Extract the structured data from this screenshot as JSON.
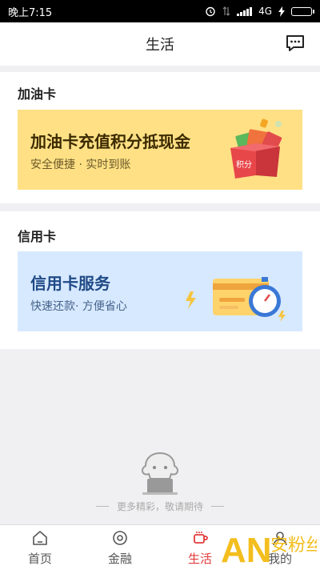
{
  "status_bar": {
    "time": "晚上7:15",
    "network": "4G"
  },
  "header": {
    "title": "生活",
    "message_icon": "message-icon"
  },
  "fuel_card": {
    "section_title": "加油卡",
    "card_title": "加油卡充值积分抵现金",
    "card_subtitle": "安全便捷 · 实时到账",
    "gift_label": "积分",
    "bg_color": "#ffe085",
    "title_color": "#3b2a00",
    "subtitle_color": "#6b5a2a"
  },
  "credit_card": {
    "section_title": "信用卡",
    "card_title": "信用卡服务",
    "card_subtitle": "快速还款· 方便省心",
    "bg_color": "#d7e9ff",
    "title_color": "#1f4a86",
    "subtitle_color": "#45628a"
  },
  "empty_state": {
    "text": "更多精彩，敬请期待"
  },
  "tab_bar": {
    "tabs": [
      {
        "label": "首页",
        "icon": "home-icon",
        "active": false
      },
      {
        "label": "金融",
        "icon": "finance-icon",
        "active": false
      },
      {
        "label": "生活",
        "icon": "life-icon",
        "active": true
      },
      {
        "label": "我的",
        "icon": "profile-icon",
        "active": false
      }
    ]
  },
  "watermark": {
    "text": "安粉丝",
    "logo": "AN"
  }
}
